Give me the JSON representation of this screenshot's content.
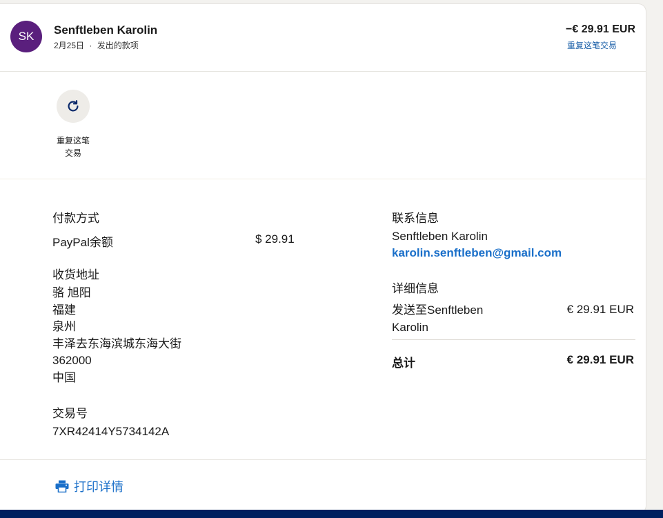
{
  "header": {
    "avatar_initials": "SK",
    "name": "Senftleben Karolin",
    "date": "2月25日",
    "separator": "·",
    "type": "发出的款项",
    "amount": "−€ 29.91 EUR",
    "repeat_link": "重复这笔交易"
  },
  "action": {
    "icon": "refresh-icon",
    "label_line1": "重复这笔",
    "label_line2": "交易"
  },
  "payment": {
    "title": "付款方式",
    "method": "PayPal余额",
    "amount": "$ 29.91"
  },
  "shipping": {
    "title": "收货地址",
    "lines": [
      "骆 旭阳",
      "福建",
      "泉州",
      "丰泽去东海滨城东海大街",
      "362000",
      "中国"
    ]
  },
  "transaction": {
    "title": "交易号",
    "id": "7XR42414Y5734142A"
  },
  "contact": {
    "title": "联系信息",
    "name": "Senftleben Karolin",
    "email": "karolin.senftleben@gmail.com"
  },
  "detail": {
    "title": "详细信息",
    "sent_to_line1": "发送至Senftleben",
    "sent_to_line2": "Karolin",
    "sent_amount": "€ 29.91 EUR",
    "total_label": "总计",
    "total_amount": "€ 29.91 EUR"
  },
  "print": {
    "icon": "printer-icon",
    "label": "打印详情"
  },
  "colors": {
    "avatar": "#5a1f7d",
    "link": "#1a6fc9",
    "footer": "#001f5f"
  }
}
